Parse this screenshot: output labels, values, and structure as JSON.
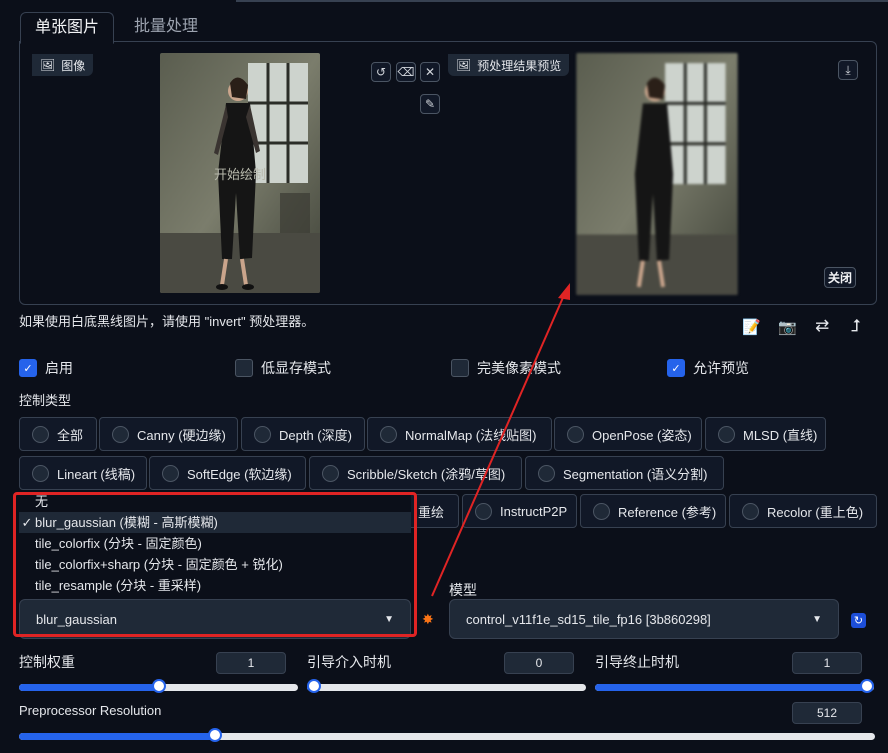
{
  "tabs": [
    {
      "label": "单张图片"
    },
    {
      "label": "批量处理"
    }
  ],
  "image_panel": {
    "input_label": "图像",
    "input_overlay_text": "开始绘制",
    "preview_label": "预处理结果预览",
    "close_label": "关闭"
  },
  "hint_text": "如果使用白底黑线图片，请使用 \"invert\" 预处理器。",
  "checkboxes": [
    {
      "label": "启用",
      "checked": true
    },
    {
      "label": "低显存模式",
      "checked": false
    },
    {
      "label": "完美像素模式",
      "checked": false
    },
    {
      "label": "允许预览",
      "checked": true
    }
  ],
  "control_type": {
    "title": "控制类型",
    "row1": [
      "全部",
      "Canny (硬边缘)",
      "Depth (深度)",
      "NormalMap (法线贴图)",
      "OpenPose (姿态)",
      "MLSD (直线)"
    ],
    "row2": [
      "Lineart (线稿)",
      "SoftEdge (软边缘)",
      "Scribble/Sketch (涂鸦/草图)",
      "Segmentation (语义分割)"
    ],
    "row3_partial": "重绘",
    "row3": [
      "InstructP2P",
      "Reference (参考)",
      "Recolor (重上色)"
    ]
  },
  "preprocessor": {
    "options": [
      "无",
      "blur_gaussian (模糊 - 高斯模糊)",
      "tile_colorfix (分块 - 固定颜色)",
      "tile_colorfix+sharp (分块 - 固定颜色 + 锐化)",
      "tile_resample (分块 - 重采样)"
    ],
    "selected_index": 1,
    "value": "blur_gaussian"
  },
  "model": {
    "label": "模型",
    "value": "control_v11f1e_sd15_tile_fp16 [3b860298]"
  },
  "sliders": {
    "weight": {
      "label": "控制权重",
      "value": "1",
      "fraction": 0.5
    },
    "start": {
      "label": "引导介入时机",
      "value": "0",
      "fraction": 0.0
    },
    "end": {
      "label": "引导终止时机",
      "value": "1",
      "fraction": 1.0
    },
    "resolution": {
      "label": "Preprocessor Resolution",
      "value": "512",
      "fraction": 0.225
    }
  },
  "colors": {
    "background": "#0b0f19",
    "accent": "#2563eb",
    "annotation_red": "#e02424"
  }
}
